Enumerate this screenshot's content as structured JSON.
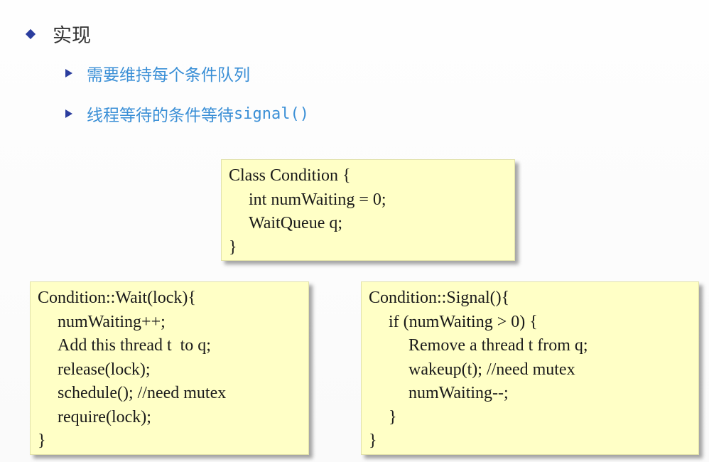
{
  "slide": {
    "main_bullet": "实现",
    "sub_bullets": [
      {
        "text": "需要维持每个条件队列",
        "suffix": ""
      },
      {
        "text": "线程等待的条件等待",
        "suffix": "signal()"
      }
    ]
  },
  "code_boxes": {
    "class_def": [
      "Class Condition {",
      "int numWaiting = 0;",
      "WaitQueue q;",
      "}"
    ],
    "wait": [
      "Condition::Wait(lock){",
      "numWaiting++;",
      "Add this thread t  to q;",
      "release(lock);",
      "schedule(); //need mutex",
      "require(lock);",
      "}"
    ],
    "signal": [
      "Condition::Signal(){",
      "if (numWaiting > 0) {",
      "Remove a thread t from q;",
      "wakeup(t); //need mutex",
      "numWaiting--;",
      "}",
      "}"
    ]
  },
  "colors": {
    "bullet_marker": "#2b3d9e",
    "sub_text": "#3a8fd6",
    "box_fill": "#ffffc6"
  }
}
